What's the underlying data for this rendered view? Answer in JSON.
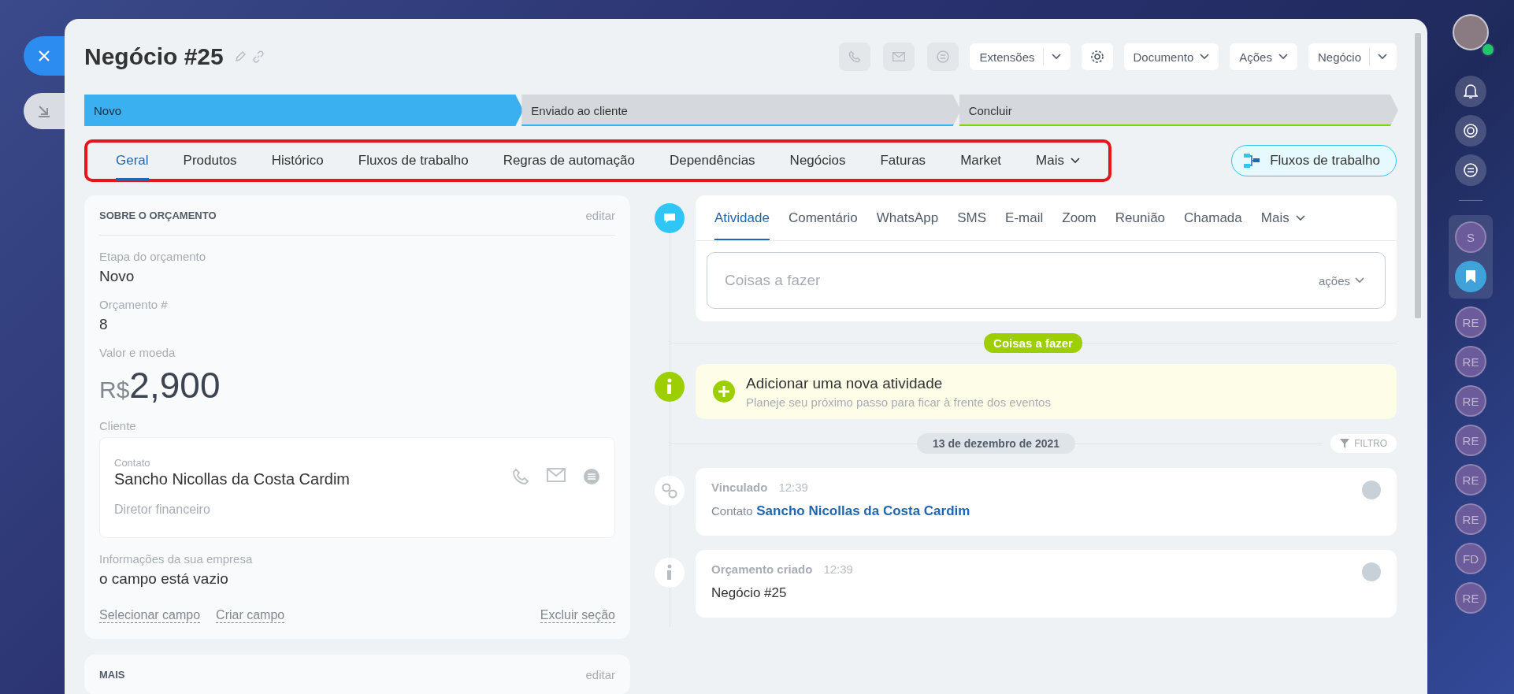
{
  "header": {
    "title": "Negócio #25",
    "buttons": [
      {
        "label": "Extensões",
        "kind": "split"
      },
      {
        "label": "Documento",
        "kind": "dropdown"
      },
      {
        "label": "Ações",
        "kind": "dropdown"
      },
      {
        "label": "Negócio",
        "kind": "split"
      }
    ]
  },
  "stages": [
    {
      "label": "Novo",
      "selected": true,
      "color": "#3bb0f0"
    },
    {
      "label": "Enviado ao cliente",
      "selected": false,
      "color": "#3bb0f0"
    },
    {
      "label": "Concluir",
      "selected": false,
      "color": "#7bd500"
    }
  ],
  "tab_bar": {
    "highlighted": true,
    "tabs": [
      {
        "label": "Geral",
        "selected": true,
        "kind": "tab"
      },
      {
        "label": "Produtos",
        "selected": false,
        "kind": "tab"
      },
      {
        "label": "Histórico",
        "selected": false,
        "kind": "tab"
      },
      {
        "label": "Fluxos de trabalho",
        "selected": false,
        "kind": "tab"
      },
      {
        "label": "Regras de automação",
        "selected": false,
        "kind": "tab"
      },
      {
        "label": "Dependências",
        "selected": false,
        "kind": "tab"
      },
      {
        "label": "Negócios",
        "selected": false,
        "kind": "tab"
      },
      {
        "label": "Faturas",
        "selected": false,
        "kind": "tab"
      },
      {
        "label": "Market",
        "selected": false,
        "kind": "tab"
      },
      {
        "label": "Mais",
        "selected": false,
        "kind": "more"
      }
    ]
  },
  "workflow_button": "Fluxos de trabalho",
  "about_card": {
    "title": "SOBRE O ORÇAMENTO",
    "edit": "editar",
    "fields": [
      {
        "kind": "text",
        "label": "Etapa do orçamento",
        "value": "Novo"
      },
      {
        "kind": "text",
        "label": "Orçamento #",
        "value": "8"
      },
      {
        "kind": "money",
        "label": "Valor e moeda",
        "currency": "R$",
        "value": "2,900"
      },
      {
        "kind": "contact",
        "label": "Cliente",
        "contact_type": "Contato",
        "name": "Sancho Nicollas da Costa Cardim",
        "position": "Diretor financeiro"
      },
      {
        "kind": "text",
        "label": "Informações da sua empresa",
        "value": "o campo está vazio"
      }
    ],
    "links": [
      "Selecionar campo",
      "Criar campo"
    ],
    "delete_link": "Excluir seção"
  },
  "more_card": {
    "title": "MAIS",
    "edit": "editar"
  },
  "composer": {
    "tabs": [
      {
        "label": "Atividade",
        "selected": true,
        "kind": "tab"
      },
      {
        "label": "Comentário",
        "selected": false,
        "kind": "tab"
      },
      {
        "label": "WhatsApp",
        "selected": false,
        "kind": "tab"
      },
      {
        "label": "SMS",
        "selected": false,
        "kind": "tab"
      },
      {
        "label": "E-mail",
        "selected": false,
        "kind": "tab"
      },
      {
        "label": "Zoom",
        "selected": false,
        "kind": "tab"
      },
      {
        "label": "Reunião",
        "selected": false,
        "kind": "tab"
      },
      {
        "label": "Chamada",
        "selected": false,
        "kind": "tab"
      },
      {
        "label": "Mais",
        "selected": false,
        "kind": "more"
      }
    ],
    "placeholder": "Coisas a fazer",
    "actions": "ações"
  },
  "todo_badge": "Coisas a fazer",
  "add_activity": {
    "title": "Adicionar uma nova atividade",
    "hint": "Planeje seu próximo passo para ficar à frente dos eventos"
  },
  "date_badge": "13 de dezembro de 2021",
  "filter": "FILTRO",
  "history": [
    {
      "kind": "link",
      "title": "Vinculado",
      "time": "12:39",
      "prefix": "Contato",
      "link": "Sancho Nicollas da Costa Cardim"
    },
    {
      "kind": "info",
      "title": "Orçamento criado",
      "time": "12:39",
      "text": "Negócio #25"
    }
  ],
  "right_bar": {
    "items": [
      {
        "kind": "initials",
        "text": "S"
      },
      {
        "kind": "bookmark"
      },
      {
        "kind": "initials",
        "text": "RE"
      },
      {
        "kind": "initials",
        "text": "RE"
      },
      {
        "kind": "initials",
        "text": "RE"
      },
      {
        "kind": "initials",
        "text": "RE"
      },
      {
        "kind": "initials",
        "text": "RE"
      },
      {
        "kind": "initials",
        "text": "RE"
      },
      {
        "kind": "initials",
        "text": "FD"
      },
      {
        "kind": "initials",
        "text": "RE"
      }
    ]
  }
}
